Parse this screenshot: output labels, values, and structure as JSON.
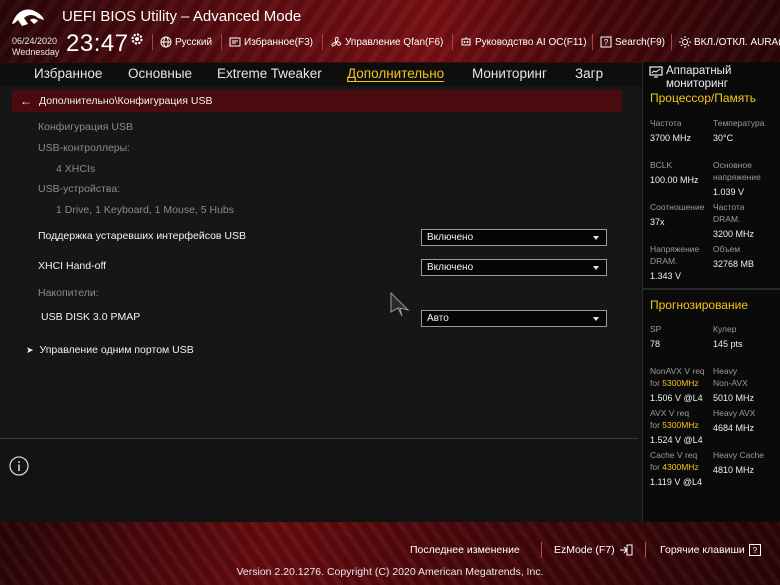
{
  "header": {
    "title": "UEFI BIOS Utility – Advanced Mode",
    "date": "06/24/2020",
    "day": "Wednesday",
    "time": "23:47",
    "language": "Русский",
    "favorites": "Избранное(F3)",
    "qfan": "Управление Qfan(F6)",
    "ai_oc": "Руководство AI OC(F11)",
    "search": "Search(F9)",
    "aura": "ВКЛ./ОТКЛ. AURA("
  },
  "nav": {
    "tabs": [
      "Избранное",
      "Основные",
      "Extreme Tweaker",
      "Дополнительно",
      "Мониторинг",
      "Загр"
    ],
    "active_index": 3
  },
  "main": {
    "breadcrumb": "Дополнительно\\Конфигурация USB",
    "section_title": "Конфигурация USB",
    "controllers_label": "USB-контроллеры:",
    "controllers_value": "4 XHCIs",
    "devices_label": "USB-устройства:",
    "devices_value": "1 Drive, 1 Keyboard, 1 Mouse, 5 Hubs",
    "legacy_label": "Поддержка устаревших интерфейсов USB",
    "legacy_value": "Включено",
    "xhci_label": "XHCI Hand-off",
    "xhci_value": "Включено",
    "storage_label": "Накопители:",
    "disk_label": "USB DISK 3.0 PMAP",
    "disk_value": "Авто",
    "port_control_label": "Управление одним портом USB"
  },
  "panel": {
    "title": "Аппаратный мониторинг",
    "cpu_memory_title": "Процессор/Память",
    "freq_label": "Частота",
    "freq_value": "3700 MHz",
    "temp_label": "Температура",
    "temp_value": "30°C",
    "bclk_label": "BCLK",
    "bclk_value": "100.00 MHz",
    "core_v_label_1": "Основное",
    "core_v_label_2": "напряжение",
    "core_v_value": "1.039 V",
    "ratio_label": "Соотношение",
    "ratio_value": "37x",
    "dram_freq_label_1": "Частота",
    "dram_freq_label_2": "DRAM.",
    "dram_freq_value": "3200 MHz",
    "dram_v_label_1": "Напряжение",
    "dram_v_label_2": "DRAM.",
    "dram_v_value": "1.343 V",
    "capacity_label": "Объем",
    "capacity_value": "32768 MB",
    "prediction_title": "Прогнозирование",
    "sp_label": "SP",
    "sp_value": "78",
    "cooler_label": "Кулер",
    "cooler_value": "145 pts",
    "nonavx_label": "NonAVX V req",
    "nonavx_for": "for",
    "nonavx_freq": "5300MHz",
    "nonavx_value": "1.506 V @L4",
    "heavy_nonavx_label_1": "Heavy",
    "heavy_nonavx_label_2": "Non-AVX",
    "heavy_nonavx_value": "5010 MHz",
    "avx_label": "AVX V req",
    "avx_for": "for",
    "avx_freq": "5300MHz",
    "avx_value": "1.524 V @L4",
    "heavy_avx_label": "Heavy AVX",
    "heavy_avx_value": "4684 MHz",
    "cache_label": "Cache V req",
    "cache_for": "for",
    "cache_freq": "4300MHz",
    "cache_value": "1.119 V @L4",
    "heavy_cache_label": "Heavy Cache",
    "heavy_cache_value": "4810 MHz"
  },
  "footer": {
    "last_change": "Последнее изменение",
    "ezmode": "EzMode (F7)",
    "hotkeys": "Горячие клавиши",
    "version": "Version 2.20.1276. Copyright (C) 2020 American Megatrends, Inc."
  },
  "colors": {
    "accent": "#f5c518",
    "brand_red": "#7a1014",
    "breadcrumb_bg": "#4a0b0e"
  },
  "icons": [
    "rog-logo-icon",
    "gear-icon",
    "globe-icon",
    "favorites-icon",
    "fan-icon",
    "ai-oc-icon",
    "search-icon",
    "aura-icon",
    "back-arrow-icon",
    "chevron-right-icon",
    "monitor-icon",
    "info-icon",
    "ezmode-icon",
    "hotkeys-icon"
  ]
}
